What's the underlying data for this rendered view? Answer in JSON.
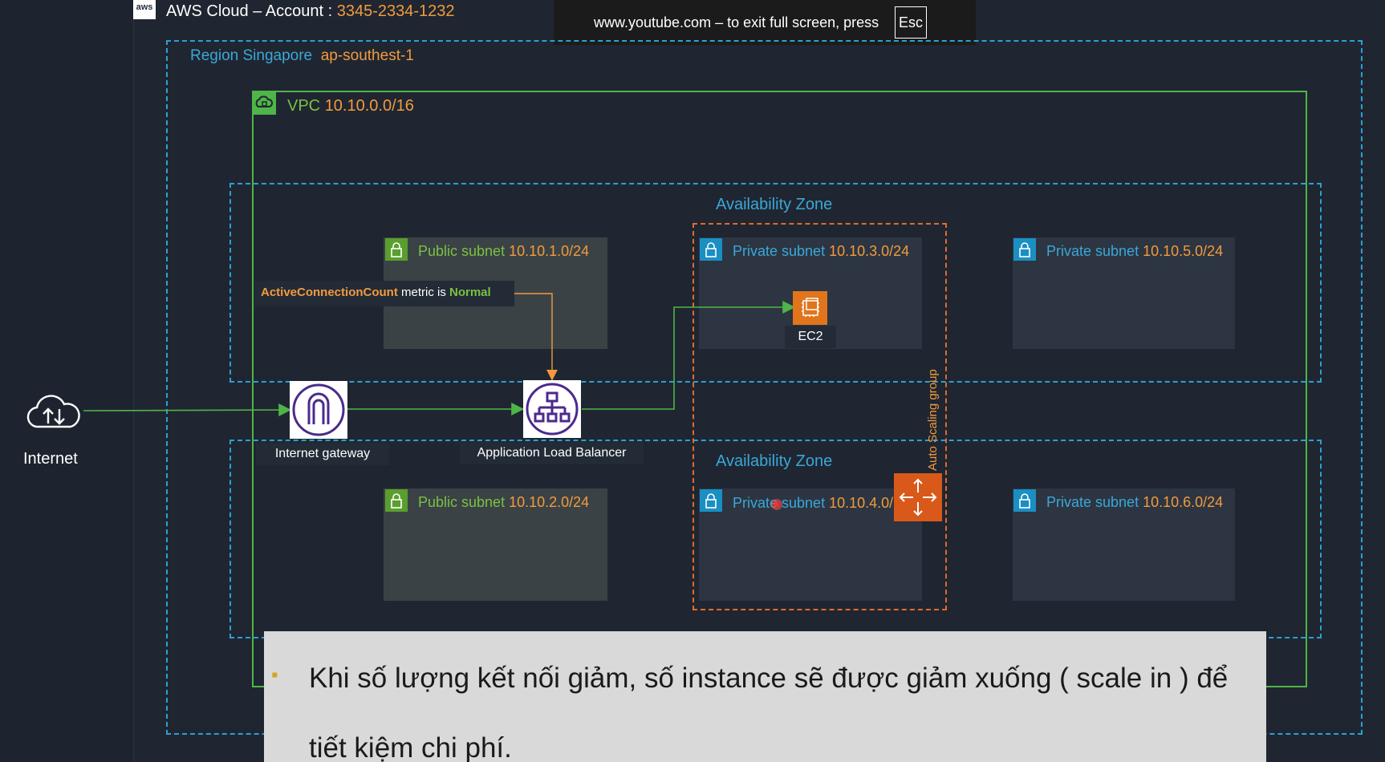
{
  "aws": {
    "logo_text": "aws",
    "title": "AWS Cloud – Account : ",
    "account": "3345-2334-1232"
  },
  "region": {
    "label": "Region Singapore",
    "code": "ap-southest-1"
  },
  "vpc": {
    "label": "VPC",
    "cidr": "10.10.0.0/16"
  },
  "fullscreen_notice": {
    "text": "www.youtube.com – to exit full screen, press",
    "key": "Esc"
  },
  "zones": [
    {
      "label": "Availability Zone"
    },
    {
      "label": "Availability Zone"
    }
  ],
  "subnets": {
    "public1": {
      "label": "Public subnet",
      "cidr": "10.10.1.0/24"
    },
    "public2": {
      "label": "Public subnet",
      "cidr": "10.10.2.0/24"
    },
    "private3": {
      "label": "Private subnet",
      "cidr": "10.10.3.0/24"
    },
    "private4": {
      "label": "Private subnet",
      "cidr": "10.10.4.0/"
    },
    "private5": {
      "label": "Private subnet",
      "cidr": "10.10.5.0/24"
    },
    "private6": {
      "label": "Private subnet",
      "cidr": "10.10.6.0/24"
    }
  },
  "metric": {
    "name": "ActiveConnectionCount",
    "middle": " metric is ",
    "state": "Normal"
  },
  "nodes": {
    "internet": "Internet",
    "igw": "Internet gateway",
    "alb": "Application Load Balancer",
    "ec2": "EC2",
    "asg": "Auto Scaling group"
  },
  "caption": {
    "bullet": "▪",
    "line1": "Khi số lượng kết nối giảm, số instance sẽ được giảm xuống ( scale in ) để",
    "line2": "tiết kiệm chi phí."
  },
  "colors": {
    "background": "#1f2631",
    "green": "#4fb548",
    "orange": "#f39a3e",
    "blue": "#2e9fd3",
    "purple": "#4b2a8c"
  }
}
